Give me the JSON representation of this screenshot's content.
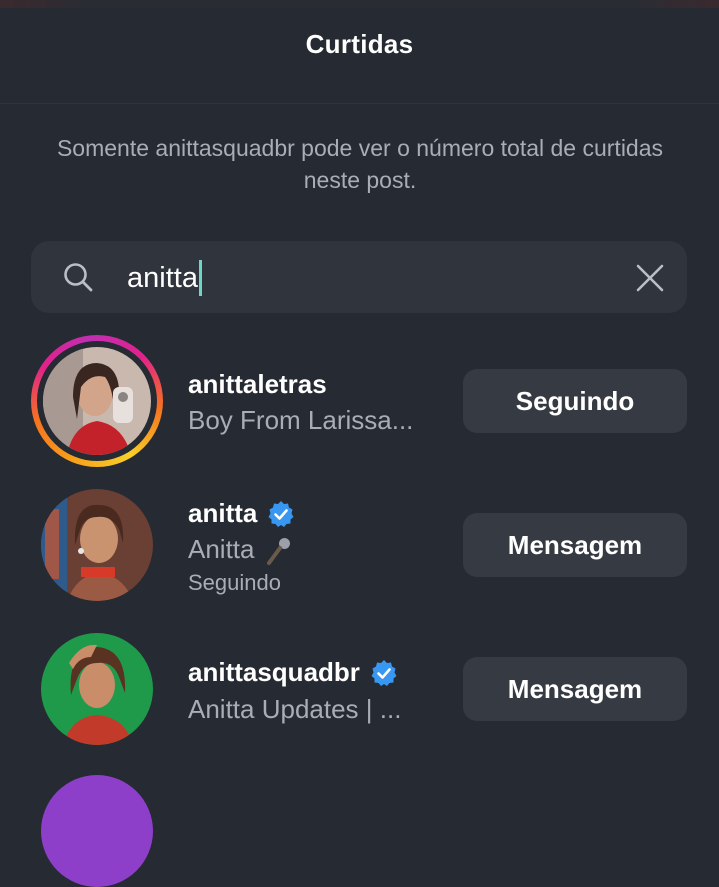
{
  "header": {
    "title": "Curtidas"
  },
  "notice": "Somente anittasquadbr pode ver o número total de curtidas neste post.",
  "search": {
    "value": "anitta",
    "icon": "search-icon",
    "clear_icon": "close-icon"
  },
  "colors": {
    "background": "#262a32",
    "field": "#30343c",
    "button": "#363a43",
    "verified": "#3897f0",
    "caret": "#6fd6c7"
  },
  "results": [
    {
      "username": "anittaletras",
      "name": "Boy From Larissa...",
      "verified": false,
      "story_ring": true,
      "button": "Seguindo"
    },
    {
      "username": "anitta",
      "name": "Anitta",
      "name_icon": "microphone-icon",
      "verified": true,
      "subtext": "Seguindo",
      "button": "Mensagem"
    },
    {
      "username": "anittasquadbr",
      "name": "Anitta Updates | ...",
      "verified": true,
      "button": "Mensagem"
    }
  ]
}
